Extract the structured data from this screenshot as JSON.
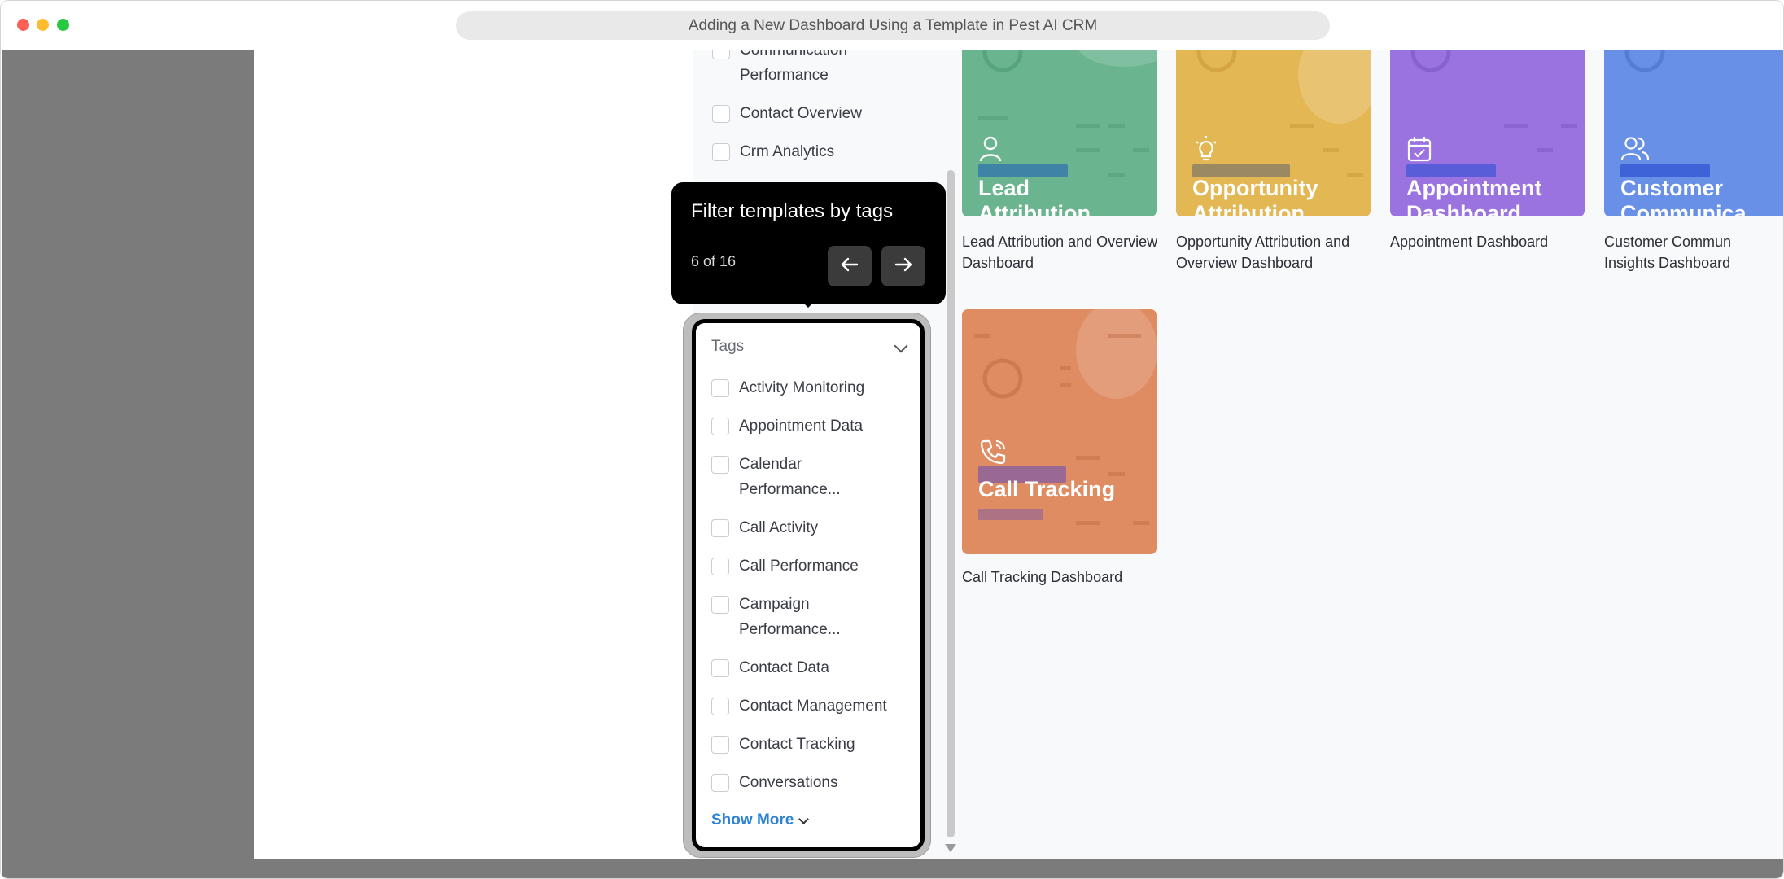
{
  "window": {
    "url_title": "Adding a New Dashboard Using a Template in Pest AI CRM"
  },
  "filters_above": {
    "items": [
      {
        "label": "Communication Performance"
      },
      {
        "label": "Contact Overview"
      },
      {
        "label": "Crm Analytics"
      }
    ]
  },
  "tooltip": {
    "title": "Filter templates by tags",
    "counter": "6 of 16",
    "prev_icon": "arrow-left-icon",
    "next_icon": "arrow-right-icon"
  },
  "tags": {
    "title": "Tags",
    "items": [
      {
        "label": "Activity Monitoring"
      },
      {
        "label": "Appointment Data"
      },
      {
        "label": "Calendar Performance..."
      },
      {
        "label": "Call Activity"
      },
      {
        "label": "Call Performance"
      },
      {
        "label": "Campaign Performance..."
      },
      {
        "label": "Contact Data"
      },
      {
        "label": "Contact Management"
      },
      {
        "label": "Contact Tracking"
      },
      {
        "label": "Conversations"
      }
    ],
    "show_more": "Show More"
  },
  "templates": [
    {
      "card_title": "Lead Attribution",
      "caption": "Lead Attribution and Overview Dashboard",
      "color": "#6ab48f",
      "icon": "user-icon"
    },
    {
      "card_title": "Opportunity Attribution",
      "caption": "Opportunity Attribution and Overview Dashboard",
      "color": "#e3b753",
      "icon": "lightbulb-icon"
    },
    {
      "card_title": "Appointment Dashboard",
      "caption": "Appointment Dashboard",
      "color": "#9a73e0",
      "icon": "calendar-check-icon"
    },
    {
      "card_title": "Customer Communica",
      "caption": "Customer Commun Insights Dashboard",
      "color": "#6790e6",
      "icon": "users-icon"
    },
    {
      "card_title": "Call Tracking",
      "caption": "Call Tracking Dashboard",
      "color": "#df8c63",
      "icon": "phone-icon"
    }
  ]
}
